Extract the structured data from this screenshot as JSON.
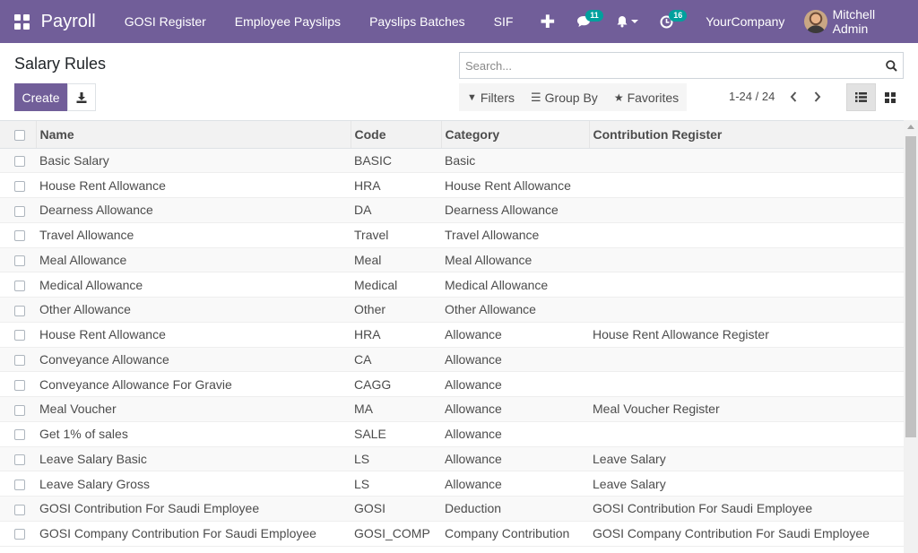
{
  "navbar": {
    "brand": "Payroll",
    "menu": [
      "GOSI Register",
      "Employee Payslips",
      "Payslips Batches",
      "SIF"
    ],
    "plus": "✚",
    "messages_count": "11",
    "activities_count": "16",
    "company": "YourCompany",
    "user": "Mitchell Admin"
  },
  "control": {
    "title": "Salary Rules",
    "search_placeholder": "Search...",
    "create_label": "Create",
    "filters_label": "Filters",
    "groupby_label": "Group By",
    "favorites_label": "Favorites",
    "pager": "1-24 / 24"
  },
  "table": {
    "headers": [
      "Name",
      "Code",
      "Category",
      "Contribution Register"
    ],
    "rows": [
      [
        "Basic Salary",
        "BASIC",
        "Basic",
        ""
      ],
      [
        "House Rent Allowance",
        "HRA",
        "House Rent Allowance",
        ""
      ],
      [
        "Dearness Allowance",
        "DA",
        "Dearness Allowance",
        ""
      ],
      [
        "Travel Allowance",
        "Travel",
        "Travel Allowance",
        ""
      ],
      [
        "Meal Allowance",
        "Meal",
        "Meal Allowance",
        ""
      ],
      [
        "Medical Allowance",
        "Medical",
        "Medical Allowance",
        ""
      ],
      [
        "Other Allowance",
        "Other",
        "Other Allowance",
        ""
      ],
      [
        "House Rent Allowance",
        "HRA",
        "Allowance",
        "House Rent Allowance Register"
      ],
      [
        "Conveyance Allowance",
        "CA",
        "Allowance",
        ""
      ],
      [
        "Conveyance Allowance For Gravie",
        "CAGG",
        "Allowance",
        ""
      ],
      [
        "Meal Voucher",
        "MA",
        "Allowance",
        "Meal Voucher Register"
      ],
      [
        "Get 1% of sales",
        "SALE",
        "Allowance",
        ""
      ],
      [
        "Leave Salary Basic",
        "LS",
        "Allowance",
        "Leave Salary"
      ],
      [
        "Leave Salary Gross",
        "LS",
        "Allowance",
        "Leave Salary"
      ],
      [
        "GOSI Contribution For Saudi Employee",
        "GOSI",
        "Deduction",
        "GOSI Contribution For Saudi Employee"
      ],
      [
        "GOSI Company Contribution For Saudi Employee",
        "GOSI_COMP",
        "Company Contribution",
        "GOSI Company Contribution For Saudi Employee"
      ]
    ]
  },
  "colors": {
    "brand": "#715e99",
    "badge": "#00a09d"
  }
}
